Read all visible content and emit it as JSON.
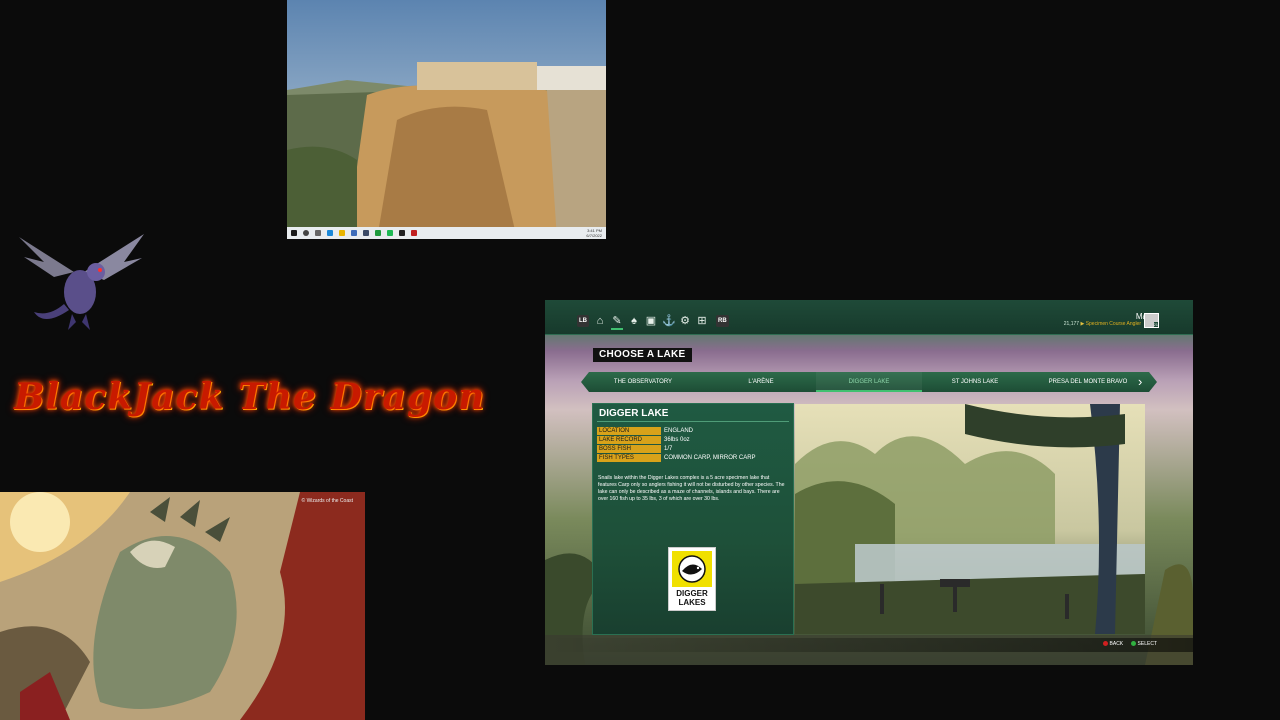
{
  "desktop_thumbnail": {
    "time": "3:41 PM",
    "date": "6/7/2022"
  },
  "branding": {
    "title": "BlackJack The Dragon",
    "art_caption": "© Wizards of the Coast"
  },
  "game": {
    "nav": {
      "lb": "LB",
      "rb": "RB",
      "icons": [
        "home-icon",
        "fishing-icon",
        "lure-icon",
        "tackle-box-icon",
        "boat-icon",
        "settings-icon",
        "basket-icon"
      ]
    },
    "player": {
      "name": "Mac",
      "money": "21,177",
      "rank": "Specimen Course Angler",
      "level": "21"
    },
    "page_title": "CHOOSE A LAKE",
    "lake_tabs": [
      "THE OBSERVATORY",
      "L'ARÈNE",
      "DIGGER LAKE",
      "ST JOHNS LAKE",
      "PRESA DEL MONTE BRAVO"
    ],
    "active_tab": "DIGGER LAKE",
    "lake": {
      "name": "DIGGER LAKE",
      "rows": [
        {
          "key": "LOCATION",
          "value": "ENGLAND"
        },
        {
          "key": "LAKE RECORD",
          "value": "36lbs 0oz"
        },
        {
          "key": "BOSS FISH",
          "value": "1/7"
        },
        {
          "key": "FISH TYPES",
          "value": "COMMON CARP, MIRROR CARP"
        }
      ],
      "description": "Snails lake within the Digger Lakes complex is a 5 acre specimen lake that features Carp only so anglers fishing it will not be disturbed by other species. The lake can only be described as a maze of channels, islands and bays. There are over 160 fish up to 35 lbs, 3 of which are over 30 lbs.",
      "logo_text_1": "DIGGER",
      "logo_text_2": "LAKES"
    },
    "footer": {
      "back": "BACK",
      "select": "SELECT",
      "back_btn": "B",
      "select_btn": "A"
    }
  },
  "colors": {
    "accent_green": "#40c070",
    "label_gold": "#d8a21a",
    "panel_green": "#1f5a42"
  }
}
